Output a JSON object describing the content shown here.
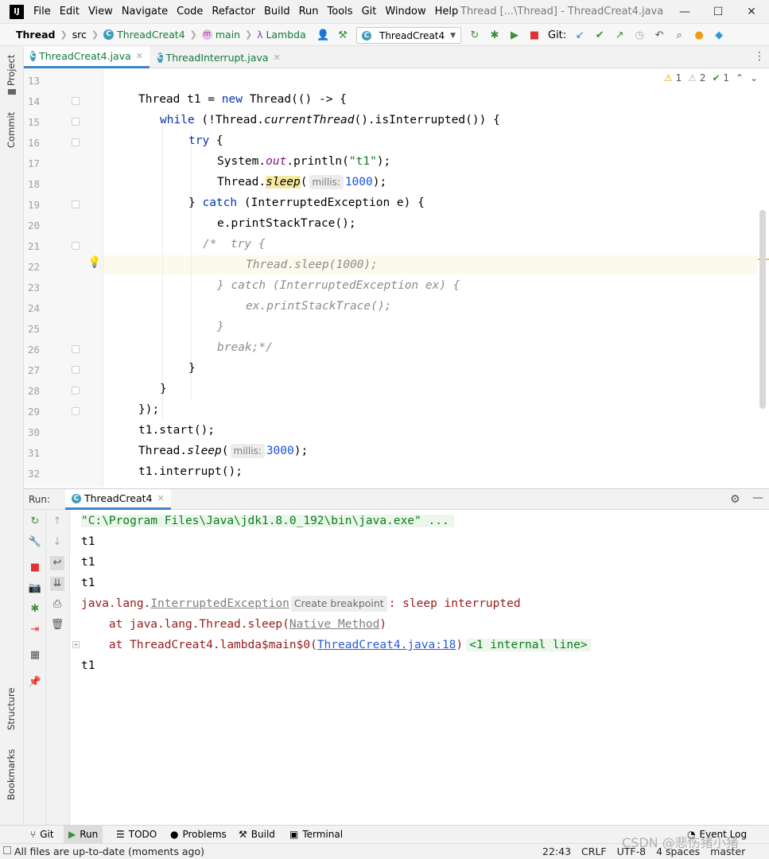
{
  "titlebar": {
    "logo": "IJ",
    "menu": [
      "File",
      "Edit",
      "View",
      "Navigate",
      "Code",
      "Refactor",
      "Build",
      "Run",
      "Tools",
      "Git",
      "Window",
      "Help"
    ],
    "title": "Thread [...\\Thread] - ThreadCreat4.java",
    "controls": {
      "minimize": "—",
      "maximize": "☐",
      "close": "✕"
    }
  },
  "navbar": {
    "project": "Thread",
    "src": "src",
    "class_name": "ThreadCreat4",
    "method": "main",
    "lambda": "Lambda",
    "run_config": "ThreadCreat4",
    "git_label": "Git:"
  },
  "left_strip": {
    "project": "Project",
    "commit": "Commit",
    "structure": "Structure",
    "bookmarks": "Bookmarks"
  },
  "editor_tabs": [
    {
      "label": "ThreadCreat4.java",
      "active": true
    },
    {
      "label": "ThreadInterrupt.java",
      "active": false
    }
  ],
  "inspections": {
    "warnings": "1",
    "weak_warnings": "2",
    "typos": "1"
  },
  "editor": {
    "line_numbers": [
      "13",
      "14",
      "15",
      "16",
      "17",
      "18",
      "19",
      "20",
      "21",
      "22",
      "23",
      "24",
      "25",
      "26",
      "27",
      "28",
      "29",
      "30",
      "31",
      "32"
    ],
    "hint_millis": "millis:",
    "l14": {
      "a": "Thread t1 = ",
      "kw": "new",
      "b": " Thread(() -> {"
    },
    "l15": {
      "kw": "while",
      "a": " (!Thread.",
      "m": "currentThread",
      "b": "().isInterrupted()) {"
    },
    "l16": {
      "kw": "try",
      "b": " {"
    },
    "l17": {
      "a": "System.",
      "f": "out",
      "b": ".println(",
      "s": "\"t1\"",
      "c": ");"
    },
    "l18": {
      "a": "Thread.",
      "m": "sleep",
      "b": "(",
      "n": "1000",
      "c": ");"
    },
    "l19": {
      "a": "} ",
      "kw": "catch",
      "b": " (InterruptedException e) {"
    },
    "l20": "e.printStackTrace();",
    "l21": "/*  try {",
    "l22": "Thread.sleep(1000);",
    "l23": "} catch (InterruptedException ex) {",
    "l24": "ex.printStackTrace();",
    "l25": "}",
    "l26": "break;*/",
    "l27": "}",
    "l28": "}",
    "l29": "});",
    "l30": "t1.start();",
    "l31": {
      "a": "Thread.",
      "m": "sleep",
      "b": "(",
      "n": "3000",
      "c": ");"
    },
    "l32": "t1.interrupt();"
  },
  "run_panel": {
    "label": "Run:",
    "tab": "ThreadCreat4",
    "console": {
      "cmd": "\"C:\\Program Files\\Java\\jdk1.8.0_192\\bin\\java.exe\" ...",
      "out1": "t1",
      "out2": "t1",
      "out3": "t1",
      "exc_prefix": "java.lang.",
      "exc_class": "InterruptedException",
      "create_bp": "Create breakpoint",
      "exc_msg": ": sleep interrupted",
      "at1_prefix": "    at java.lang.Thread.sleep(",
      "at1_link": "Native Method",
      "at1_suffix": ")",
      "at2_prefix": "    at ThreadCreat4.lambda$main$0(",
      "at2_link": "ThreadCreat4.java:18",
      "at2_suffix": ")",
      "internal": "<1 internal line>",
      "out4": "t1"
    }
  },
  "bottom_bar": {
    "git": "Git",
    "run": "Run",
    "todo": "TODO",
    "problems": "Problems",
    "build": "Build",
    "terminal": "Terminal",
    "event_log": "Event Log"
  },
  "status_bar": {
    "message": "All files are up-to-date (moments ago)",
    "position": "22:43",
    "line_sep": "CRLF",
    "encoding": "UTF-8",
    "indent": "4 spaces",
    "branch": "master"
  },
  "watermark": "CSDN @悲伤猪小猪",
  "colors": {
    "keyword": "#0033b3",
    "string": "#067d17",
    "number": "#1750eb",
    "comment": "#8c8c8c",
    "error": "#971a1a",
    "accent": "#4083c9"
  }
}
